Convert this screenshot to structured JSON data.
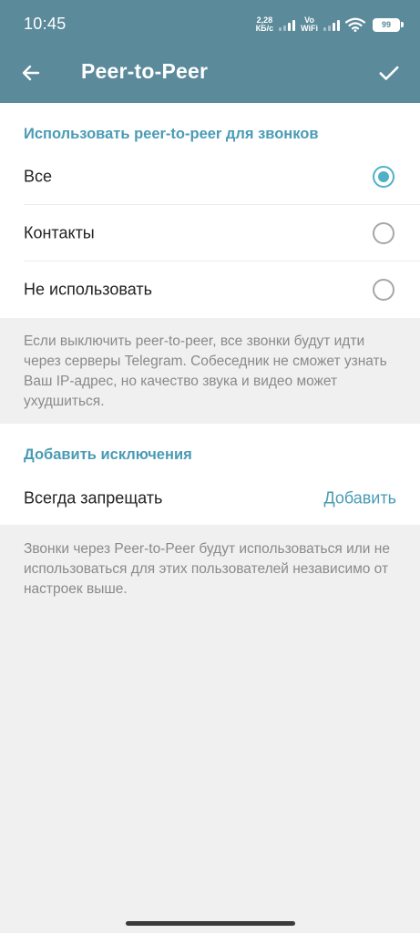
{
  "status_bar": {
    "time": "10:45",
    "net_speed_value": "2,28",
    "net_speed_unit": "КБ/с",
    "vo_top": "Vo",
    "vo_bottom": "WiFi",
    "battery": "99"
  },
  "header": {
    "title": "Peer-to-Peer",
    "back_icon": "arrow-left-icon",
    "confirm_icon": "checkmark-icon"
  },
  "p2p_section": {
    "header": "Использовать peer-to-peer для звонков",
    "options": [
      {
        "label": "Все",
        "selected": true
      },
      {
        "label": "Контакты",
        "selected": false
      },
      {
        "label": "Не использовать",
        "selected": false
      }
    ]
  },
  "p2p_info": "Если выключить peer-to-peer, все звонки будут идти через серверы Telegram. Собеседник не сможет узнать Ваш IP-адрес, но качество звука и видео может ухудшиться.",
  "exceptions_section": {
    "header": "Добавить исключения",
    "row_label": "Всегда запрещать",
    "add_label": "Добавить"
  },
  "exceptions_info": "Звонки через Peer-to-Peer будут использоваться или не использоваться для этих пользователей независимо от настроек выше.",
  "colors": {
    "header_bg": "#5b8a9b",
    "accent": "#4a9bb5",
    "radio_active": "#4fb0ca",
    "page_bg": "#f0f0f0"
  }
}
